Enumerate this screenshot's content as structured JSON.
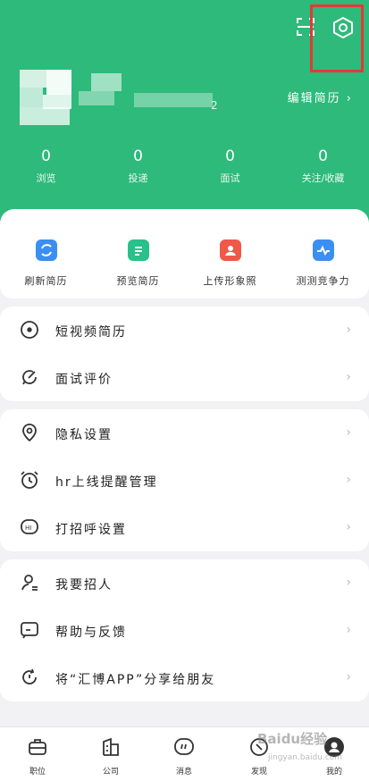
{
  "header": {
    "edit_profile": "编辑简历 ›"
  },
  "stats": [
    {
      "value": "0",
      "label": "浏览"
    },
    {
      "value": "0",
      "label": "投递"
    },
    {
      "value": "0",
      "label": "面试"
    },
    {
      "value": "0",
      "label": "关注/收藏"
    }
  ],
  "quick_actions": [
    {
      "label": "刷新简历",
      "icon": "refresh-icon",
      "color": "#3b8ff3"
    },
    {
      "label": "预览简历",
      "icon": "document-icon",
      "color": "#29c08a"
    },
    {
      "label": "上传形象照",
      "icon": "portrait-icon",
      "color": "#f0584a"
    },
    {
      "label": "测测竞争力",
      "icon": "pulse-chart-icon",
      "color": "#3b8ff3"
    }
  ],
  "menu_group1": [
    {
      "label": "短视频简历",
      "icon": "play-circle-icon"
    },
    {
      "label": "面试评价",
      "icon": "edit-bubble-icon"
    }
  ],
  "menu_group2": [
    {
      "label": "隐私设置",
      "icon": "location-shield-icon"
    },
    {
      "label": "hr上线提醒管理",
      "icon": "alarm-clock-icon"
    },
    {
      "label": "打招呼设置",
      "icon": "hi-bubble-icon"
    }
  ],
  "menu_group3": [
    {
      "label": "我要招人",
      "icon": "person-icon"
    },
    {
      "label": "帮助与反馈",
      "icon": "feedback-icon"
    },
    {
      "label": "将“汇博APP”分享给朋友",
      "icon": "share-icon"
    }
  ],
  "tabs": [
    {
      "label": "职位",
      "icon": "briefcase-icon"
    },
    {
      "label": "公司",
      "icon": "building-icon"
    },
    {
      "label": "消息",
      "icon": "message-icon"
    },
    {
      "label": "发现",
      "icon": "discover-icon"
    },
    {
      "label": "我的",
      "icon": "profile-icon"
    }
  ],
  "watermark": {
    "main": "Baidu经验",
    "sub": "jingyan.baidu.com"
  }
}
